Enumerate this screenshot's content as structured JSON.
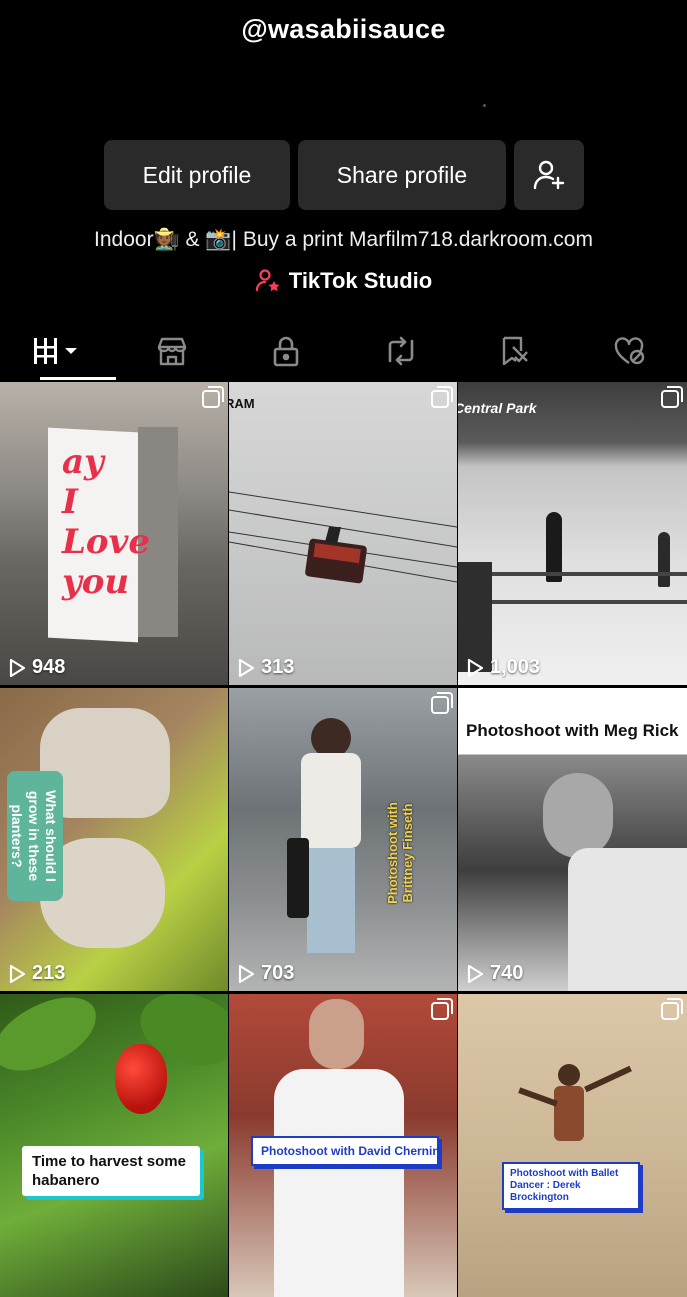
{
  "profile": {
    "username": "@wasabiisauce",
    "edit_label": "Edit profile",
    "share_label": "Share profile",
    "bio": "Indoor🧑🏾‍🌾 & 📸| Buy a print Marfilm718.darkroom.com",
    "studio_label": "TikTok Studio"
  },
  "tabs": [
    {
      "icon": "videos-grid-icon"
    },
    {
      "icon": "shop-icon"
    },
    {
      "icon": "lock-icon"
    },
    {
      "icon": "repost-icon"
    },
    {
      "icon": "favorites-icon"
    },
    {
      "icon": "liked-icon"
    }
  ],
  "videos": [
    {
      "views": "948",
      "overlay": "ay\nI\nLove\nyou"
    },
    {
      "views": "313",
      "overlay": "RAM"
    },
    {
      "views": "1,003",
      "overlay": "Central Park"
    },
    {
      "views": "213",
      "overlay": "What should I grow in these planters?"
    },
    {
      "views": "703",
      "overlay": "Photoshoot with Brittney Finseth"
    },
    {
      "views": "740",
      "overlay": "Photoshoot with Meg Rick"
    },
    {
      "views": "",
      "overlay": "Time to harvest some habanero"
    },
    {
      "views": "",
      "overlay": "Photoshoot with David Chernin"
    },
    {
      "views": "",
      "overlay": "Photoshoot with Ballet Dancer : Derek Brockington"
    }
  ],
  "colors": {
    "background": "#000000",
    "button": "#2a2a2a",
    "studio_accent": "#ff3b5c"
  }
}
